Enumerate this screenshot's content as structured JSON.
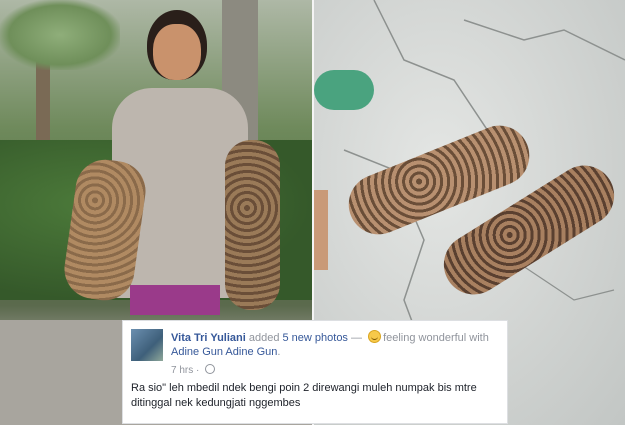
{
  "post": {
    "author": "Vita Tri Yuliani",
    "action": " added ",
    "photos_link": "5 new photos",
    "feeling_prefix": " — ",
    "feeling": "feeling wonderful with",
    "tagged": "Adine Gun Adine Gun",
    "tagged_suffix": ".",
    "timestamp": "7 hrs",
    "separator": " · ",
    "text": "Ra sio\" leh mbedil ndek bengi poin 2 direwangi muleh numpak bis mtre ditinggal nek kedungjati nggembes"
  },
  "icons": {
    "feeling": "smiley-icon",
    "privacy": "globe-icon"
  },
  "colors": {
    "link": "#365899",
    "meta": "#90949c",
    "text": "#1d2129"
  }
}
